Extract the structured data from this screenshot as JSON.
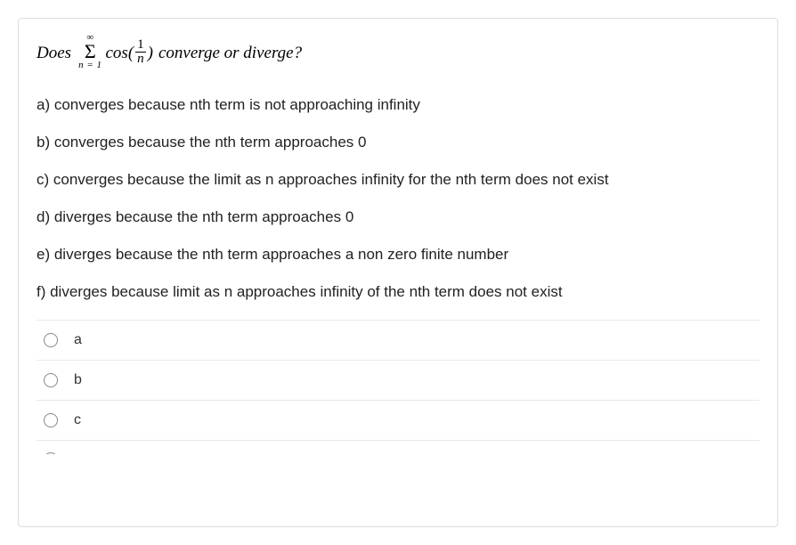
{
  "question": {
    "prefix": "Does",
    "sum_upper": "∞",
    "sum_sigma": "Σ",
    "sum_lower": "n = 1",
    "cos_label": "cos(",
    "frac_num": "1",
    "frac_den": "n",
    "cos_close": ")",
    "suffix": "converge or diverge?"
  },
  "answer_texts": {
    "a": "a) converges because nth term is not approaching infinity",
    "b": "b) converges because the nth term approaches 0",
    "c": "c) converges because the limit as n approaches infinity for the nth term does not exist",
    "d": "d) diverges because the nth term approaches 0",
    "e": "e) diverges because the nth term approaches a non zero finite number",
    "f": "f) diverges because limit as n approaches infinity of the nth term does not exist"
  },
  "radio_options": {
    "a": "a",
    "b": "b",
    "c": "c"
  }
}
